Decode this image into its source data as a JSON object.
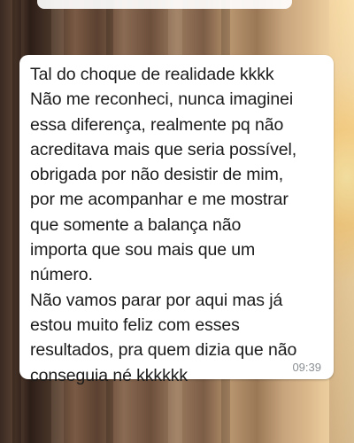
{
  "message": {
    "lines": [
      "Tal do choque de realidade kkkk",
      "Não me reconheci, nunca imaginei",
      "essa diferença, realmente pq não",
      "acreditava mais que seria possível,",
      "obrigada por não desistir de mim,",
      "por me acompanhar e me mostrar",
      "que somente a balança não",
      "importa que sou mais que um",
      "número.",
      "Não vamos parar por aqui mas já",
      "estou muito feliz com esses",
      "resultados, pra quem dizia que não",
      "conseguia né kkkkkk"
    ],
    "time": "09:39"
  },
  "colors": {
    "bubble": "#ffffff",
    "text": "#1b1b1b",
    "time": "#8a8f93"
  }
}
